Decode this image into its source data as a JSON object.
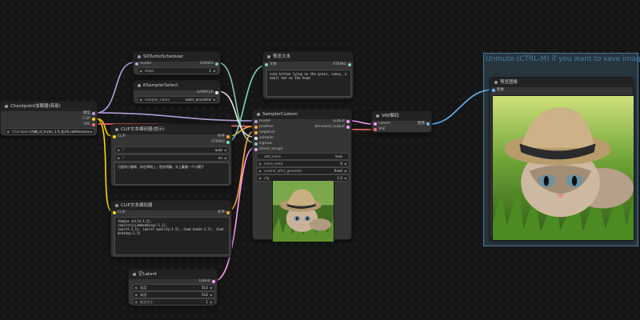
{
  "group": {
    "title": "Unmute (CTRL-M) if you want to save images."
  },
  "checkpoint": {
    "title": "Checkpoint加载器(简易)",
    "outputs": [
      "模型",
      "CLIP",
      "VAE"
    ],
    "ckpt_name": "Checkpoint名称",
    "ckpt_value": "sd_xl_turbo_1.0_fp16.safetensors"
  },
  "scheduler": {
    "title": "SDTurboScheduler",
    "input_label": "model",
    "output_label": "SIGMAS",
    "steps_label": "steps",
    "steps_value": "1"
  },
  "sampler_select": {
    "title": "KSamplerSelect",
    "output_label": "SAMPLER",
    "sampler_label": "sampler_name",
    "sampler_value": "euler_ancestral"
  },
  "preview_text": {
    "title": "预览文本",
    "input_label": "文本",
    "output_label": "STRING",
    "content": "cute kitten lying on the grass, sunny, a small hat on the head"
  },
  "clip_encode_1": {
    "title": "CLIP文本编码器(提示)",
    "input_label": "CLIP",
    "outputs": [
      "条件",
      "STRING"
    ],
    "w1_label": "?",
    "w1_value": "auto",
    "w2_label": "?",
    "w2_value": "on",
    "text": "可爱的小猫咪，趴在草地上，阳光明媚，头上戴着一个小帽子"
  },
  "clip_encode_2": {
    "title": "CLIP文本编码器",
    "input_label": "CLIP",
    "output_label": "条件",
    "text": "female child:1.5),\nrealistic(embedding):1.1),\n(worst:1.5), (worst quality:1.5), (bad hands:1.5), (bad anatomy:1.5)"
  },
  "sampler_custom": {
    "title": "SamplerCustom",
    "inputs": [
      "model",
      "positive",
      "negative",
      "sampler",
      "sigmas",
      "latent_image"
    ],
    "outputs": [
      "output",
      "denoised_output"
    ],
    "widgets": [
      {
        "label": "add_noise",
        "value": "true"
      },
      {
        "label": "noise_seed",
        "value": "0"
      },
      {
        "label": "control_after_generate",
        "value": "fixed"
      },
      {
        "label": "cfg",
        "value": "1.0"
      }
    ]
  },
  "vae_decode": {
    "title": "VAE解码",
    "inputs": [
      "Latent",
      "VAE"
    ],
    "output_label": "图像"
  },
  "preview_image": {
    "title": "预览图像",
    "input_label": "图像"
  },
  "empty_latent": {
    "title": "空Latent",
    "output_label": "Latent",
    "widgets": [
      {
        "label": "宽度",
        "value": "512"
      },
      {
        "label": "高度",
        "value": "512"
      },
      {
        "label": "批次大小",
        "value": "1"
      }
    ]
  },
  "colors": {
    "model": "#b39ddb",
    "clip": "#ffd500",
    "vae": "#ff6e6e",
    "conditioning": "#ffa931",
    "latent": "#ff9cf9",
    "image": "#64b5f6",
    "sigmas": "#7fc9a3",
    "sampler": "#e8e8e8",
    "string": "#77d6c2",
    "group_title": "#3e7fa6"
  }
}
